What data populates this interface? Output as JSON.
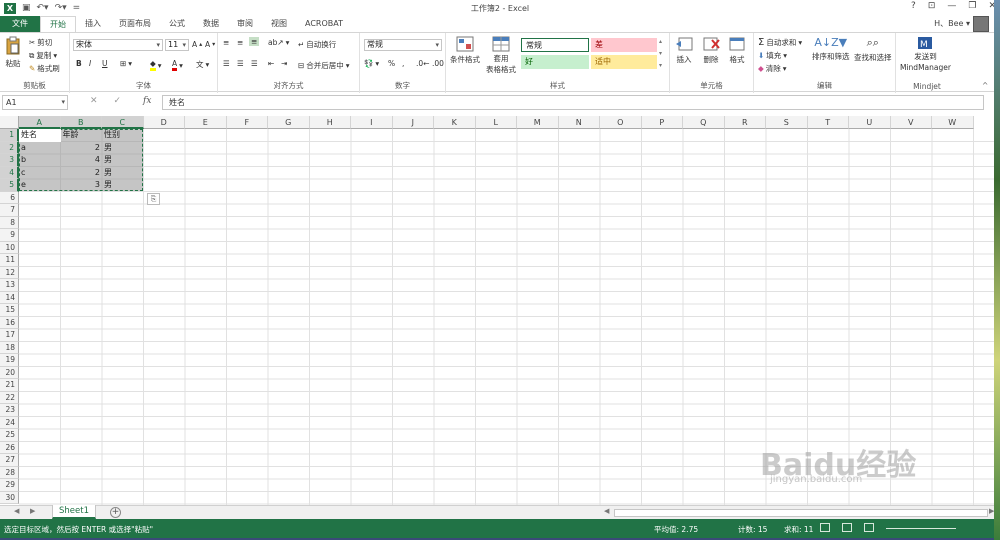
{
  "app": {
    "title": "工作簿2 - Excel",
    "user": "H、Bee ▾",
    "help": "?",
    "win_controls": [
      "⊡",
      "—",
      "❐",
      "✕"
    ]
  },
  "tabs": [
    "文件",
    "开始",
    "插入",
    "页面布局",
    "公式",
    "数据",
    "审阅",
    "视图",
    "ACROBAT"
  ],
  "active_tab": "开始",
  "ribbon": {
    "clipboard": {
      "label": "剪贴板",
      "paste": "粘贴",
      "cut": "剪切",
      "copy": "复制",
      "format_painter": "格式刷"
    },
    "font": {
      "label": "字体",
      "font_name": "宋体",
      "font_size": "11",
      "bold": "B",
      "italic": "I",
      "underline": "U"
    },
    "alignment": {
      "label": "对齐方式",
      "wrap": "自动换行",
      "merge": "合并后居中"
    },
    "number": {
      "label": "数字",
      "format": "常规"
    },
    "styles": {
      "label": "样式",
      "conditional": "条件格式",
      "table_format_1": "套用",
      "table_format_2": "表格格式",
      "normal": "常规",
      "bad": "差",
      "good": "好",
      "neutral": "适中"
    },
    "cells": {
      "label": "单元格",
      "insert": "插入",
      "delete": "删除",
      "format": "格式"
    },
    "editing": {
      "label": "编辑",
      "autosum": "自动求和",
      "fill": "填充",
      "clear": "清除",
      "sort": "排序和筛选",
      "find": "查找和选择"
    },
    "mindjet": {
      "label": "Mindjet",
      "send1": "发送到",
      "send2": "MindManager"
    }
  },
  "formula": {
    "name_box": "A1",
    "cancel": "✕",
    "enter": "✓",
    "fx": "fx",
    "content": "姓名"
  },
  "columns": [
    "A",
    "B",
    "C",
    "D",
    "E",
    "F",
    "G",
    "H",
    "I",
    "J",
    "K",
    "L",
    "M",
    "N",
    "O",
    "P",
    "Q",
    "R",
    "S",
    "T",
    "U",
    "V",
    "W"
  ],
  "rows": [
    "1",
    "2",
    "3",
    "4",
    "5",
    "6",
    "7",
    "8",
    "9",
    "10",
    "11",
    "12",
    "13",
    "14",
    "15",
    "16",
    "17",
    "18",
    "19",
    "20",
    "21",
    "22",
    "23",
    "24",
    "25",
    "26",
    "27",
    "28",
    "29",
    "30"
  ],
  "table": [
    [
      "姓名",
      "年龄",
      "性别"
    ],
    [
      "a",
      "2",
      "男"
    ],
    [
      "b",
      "4",
      "男"
    ],
    [
      "c",
      "2",
      "男"
    ],
    [
      "e",
      "3",
      "男"
    ]
  ],
  "sheet": {
    "name": "Sheet1",
    "add": "+"
  },
  "status": {
    "message": "选定目标区域，然后按 ENTER 或选择\"粘贴\"",
    "average": "平均值: 2.75",
    "count": "计数: 15",
    "sum": "求和: 11"
  },
  "colors": {
    "accent": "#217346",
    "bad_bg": "#ffc7ce",
    "good_bg": "#c6efce",
    "neutral_bg": "#ffeb9c"
  },
  "watermark": {
    "main": "Baidu经验",
    "sub": "jingyan.baidu.com"
  }
}
